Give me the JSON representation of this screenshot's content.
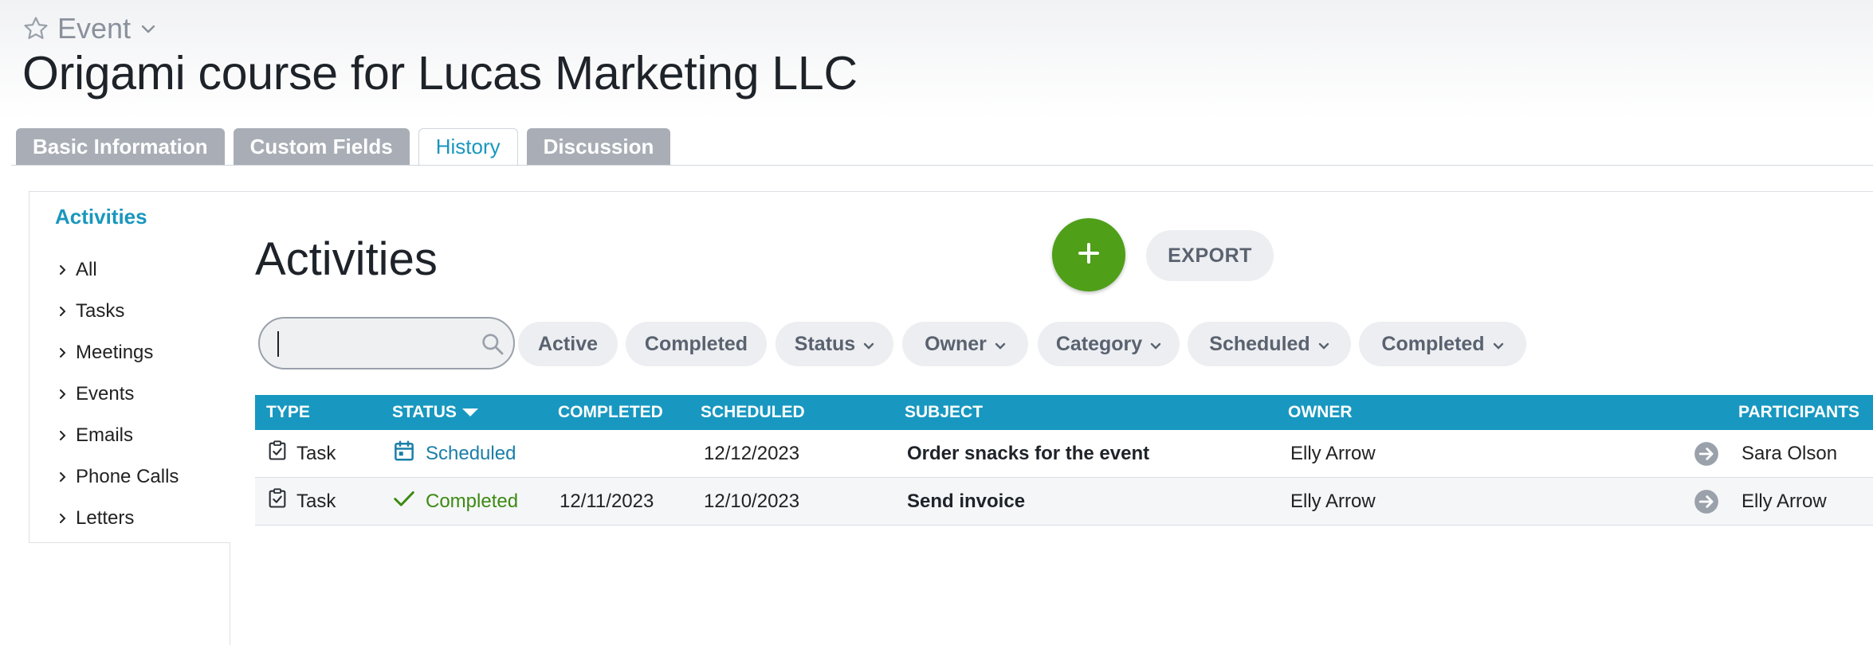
{
  "header": {
    "record_type": "Event",
    "title": "Origami course for Lucas Marketing LLC"
  },
  "tabs": [
    {
      "label": "Basic Information",
      "active": false
    },
    {
      "label": "Custom Fields",
      "active": false
    },
    {
      "label": "History",
      "active": true
    },
    {
      "label": "Discussion",
      "active": false
    }
  ],
  "sidebar": {
    "title": "Activities",
    "items": [
      {
        "label": "All"
      },
      {
        "label": "Tasks"
      },
      {
        "label": "Meetings"
      },
      {
        "label": "Events"
      },
      {
        "label": "Emails"
      },
      {
        "label": "Phone Calls"
      },
      {
        "label": "Letters"
      }
    ]
  },
  "main": {
    "title": "Activities",
    "add_icon": "plus-icon",
    "export_label": "EXPORT"
  },
  "filters": {
    "search_value": "",
    "search_placeholder": "",
    "chips": [
      {
        "label": "Active",
        "dropdown": false
      },
      {
        "label": "Completed",
        "dropdown": false
      },
      {
        "label": "Status",
        "dropdown": true
      },
      {
        "label": "Owner",
        "dropdown": true
      },
      {
        "label": "Category",
        "dropdown": true
      },
      {
        "label": "Scheduled",
        "dropdown": true
      },
      {
        "label": "Completed",
        "dropdown": true
      }
    ]
  },
  "grid": {
    "columns": {
      "type": "TYPE",
      "status": "STATUS",
      "completed": "COMPLETED",
      "scheduled": "SCHEDULED",
      "subject": "SUBJECT",
      "owner": "OWNER",
      "participants": "PARTICIPANTS"
    },
    "sort": {
      "column": "status",
      "direction": "desc"
    },
    "rows": [
      {
        "type": "Task",
        "status": "Scheduled",
        "completed": "",
        "scheduled": "12/12/2023",
        "subject": "Order snacks for the event",
        "owner": "Elly Arrow",
        "participants": "Sara Olson"
      },
      {
        "type": "Task",
        "status": "Completed",
        "completed": "12/11/2023",
        "scheduled": "12/10/2023",
        "subject": "Send invoice",
        "owner": "Elly Arrow",
        "participants": "Elly Arrow"
      }
    ]
  },
  "colors": {
    "accent": "#1a97bd",
    "header_bg": "#1898c1",
    "add_button": "#4f9f19",
    "completed_status": "#3c8a12",
    "inactive_tab": "#a9aeb6"
  }
}
